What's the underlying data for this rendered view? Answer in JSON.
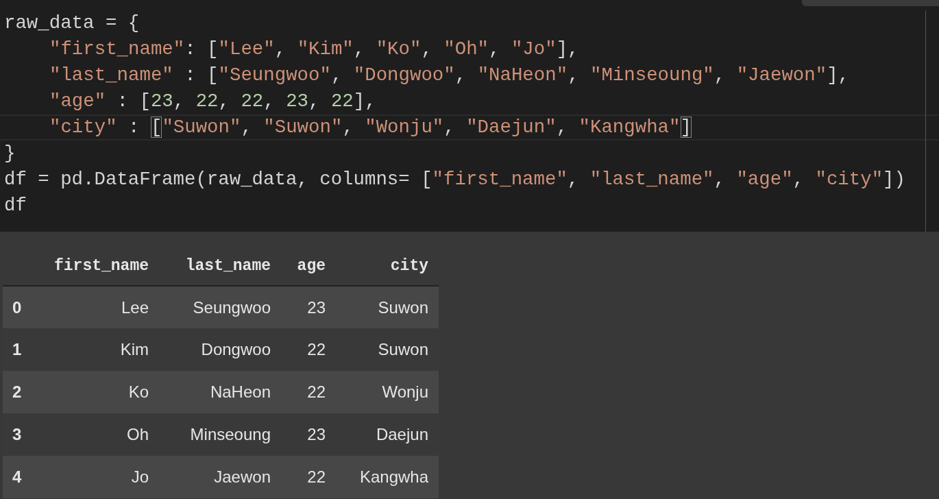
{
  "code": {
    "lines": [
      {
        "current": false,
        "indent": false,
        "tokens": [
          {
            "kind": "plain",
            "text": "raw_data = {"
          }
        ]
      },
      {
        "current": false,
        "indent": true,
        "tokens": [
          {
            "kind": "string",
            "text": "\"first_name\""
          },
          {
            "kind": "plain",
            "text": ": ["
          },
          {
            "kind": "string",
            "text": "\"Lee\""
          },
          {
            "kind": "plain",
            "text": ", "
          },
          {
            "kind": "string",
            "text": "\"Kim\""
          },
          {
            "kind": "plain",
            "text": ", "
          },
          {
            "kind": "string",
            "text": "\"Ko\""
          },
          {
            "kind": "plain",
            "text": ", "
          },
          {
            "kind": "string",
            "text": "\"Oh\""
          },
          {
            "kind": "plain",
            "text": ", "
          },
          {
            "kind": "string",
            "text": "\"Jo\""
          },
          {
            "kind": "plain",
            "text": "],"
          }
        ]
      },
      {
        "current": false,
        "indent": true,
        "tokens": [
          {
            "kind": "string",
            "text": "\"last_name\""
          },
          {
            "kind": "plain",
            "text": " : ["
          },
          {
            "kind": "string",
            "text": "\"Seungwoo\""
          },
          {
            "kind": "plain",
            "text": ", "
          },
          {
            "kind": "string",
            "text": "\"Dongwoo\""
          },
          {
            "kind": "plain",
            "text": ", "
          },
          {
            "kind": "string",
            "text": "\"NaHeon\""
          },
          {
            "kind": "plain",
            "text": ", "
          },
          {
            "kind": "string",
            "text": "\"Minseoung\""
          },
          {
            "kind": "plain",
            "text": ", "
          },
          {
            "kind": "string",
            "text": "\"Jaewon\""
          },
          {
            "kind": "plain",
            "text": "],"
          }
        ]
      },
      {
        "current": false,
        "indent": true,
        "tokens": [
          {
            "kind": "string",
            "text": "\"age\""
          },
          {
            "kind": "plain",
            "text": " : ["
          },
          {
            "kind": "number",
            "text": "23"
          },
          {
            "kind": "plain",
            "text": ", "
          },
          {
            "kind": "number",
            "text": "22"
          },
          {
            "kind": "plain",
            "text": ", "
          },
          {
            "kind": "number",
            "text": "22"
          },
          {
            "kind": "plain",
            "text": ", "
          },
          {
            "kind": "number",
            "text": "23"
          },
          {
            "kind": "plain",
            "text": ", "
          },
          {
            "kind": "number",
            "text": "22"
          },
          {
            "kind": "plain",
            "text": "],"
          }
        ]
      },
      {
        "current": true,
        "indent": true,
        "tokens": [
          {
            "kind": "string",
            "text": "\"city\""
          },
          {
            "kind": "plain",
            "text": " : "
          },
          {
            "kind": "bracket_match",
            "text": "["
          },
          {
            "kind": "string",
            "text": "\"Suwon\""
          },
          {
            "kind": "plain",
            "text": ", "
          },
          {
            "kind": "string",
            "text": "\"Suwon\""
          },
          {
            "kind": "plain",
            "text": ", "
          },
          {
            "kind": "string",
            "text": "\"Wonju\""
          },
          {
            "kind": "plain",
            "text": ", "
          },
          {
            "kind": "string",
            "text": "\"Daejun\""
          },
          {
            "kind": "plain",
            "text": ", "
          },
          {
            "kind": "string",
            "text": "\"Kangwha\""
          },
          {
            "kind": "bracket_match",
            "text": "]"
          }
        ]
      },
      {
        "current": false,
        "indent": false,
        "tokens": [
          {
            "kind": "plain",
            "text": "}"
          }
        ]
      },
      {
        "current": false,
        "indent": false,
        "tokens": [
          {
            "kind": "plain",
            "text": "df = pd.DataFrame(raw_data, columns= ["
          },
          {
            "kind": "string",
            "text": "\"first_name\""
          },
          {
            "kind": "plain",
            "text": ", "
          },
          {
            "kind": "string",
            "text": "\"last_name\""
          },
          {
            "kind": "plain",
            "text": ", "
          },
          {
            "kind": "string",
            "text": "\"age\""
          },
          {
            "kind": "plain",
            "text": ", "
          },
          {
            "kind": "string",
            "text": "\"city\""
          },
          {
            "kind": "plain",
            "text": "])"
          }
        ]
      },
      {
        "current": false,
        "indent": false,
        "tokens": [
          {
            "kind": "plain",
            "text": "df"
          }
        ]
      }
    ]
  },
  "output_table": {
    "columns": [
      "first_name",
      "last_name",
      "age",
      "city"
    ],
    "rows": [
      {
        "index": "0",
        "cells": [
          "Lee",
          "Seungwoo",
          "23",
          "Suwon"
        ]
      },
      {
        "index": "1",
        "cells": [
          "Kim",
          "Dongwoo",
          "22",
          "Suwon"
        ]
      },
      {
        "index": "2",
        "cells": [
          "Ko",
          "NaHeon",
          "22",
          "Wonju"
        ]
      },
      {
        "index": "3",
        "cells": [
          "Oh",
          "Minseoung",
          "23",
          "Daejun"
        ]
      },
      {
        "index": "4",
        "cells": [
          "Jo",
          "Jaewon",
          "22",
          "Kangwha"
        ]
      }
    ]
  }
}
